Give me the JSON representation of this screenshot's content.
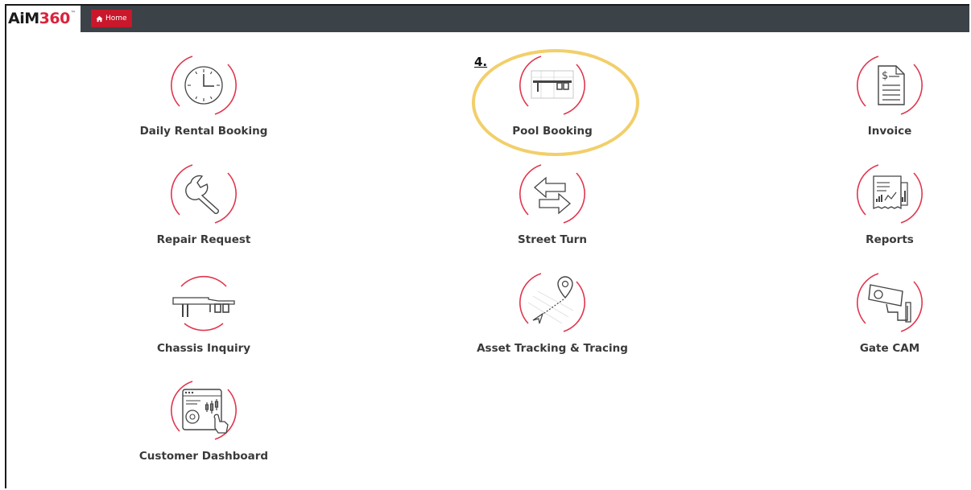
{
  "header": {
    "logo_main": "AiM",
    "logo_accent": "360",
    "logo_tm": "™",
    "home_label": "Home",
    "accent_color": "#c9172b",
    "bar_color": "#3b4248"
  },
  "annotation": {
    "step_label": "4.",
    "highlight_color": "#f2cf6a"
  },
  "tiles": [
    {
      "label": "Daily Rental Booking",
      "icon": "clock-icon"
    },
    {
      "label": "Pool Booking",
      "icon": "chassis-pool-icon"
    },
    {
      "label": "Invoice",
      "icon": "invoice-icon"
    },
    {
      "label": "Repair Request",
      "icon": "wrench-icon"
    },
    {
      "label": "Street Turn",
      "icon": "arrows-left-right-icon"
    },
    {
      "label": "Reports",
      "icon": "reports-icon"
    },
    {
      "label": "Chassis Inquiry",
      "icon": "chassis-icon"
    },
    {
      "label": "Asset Tracking & Tracing",
      "icon": "location-pin-icon"
    },
    {
      "label": "Gate CAM",
      "icon": "security-camera-icon"
    },
    {
      "label": "Customer Dashboard",
      "icon": "dashboard-icon"
    }
  ]
}
